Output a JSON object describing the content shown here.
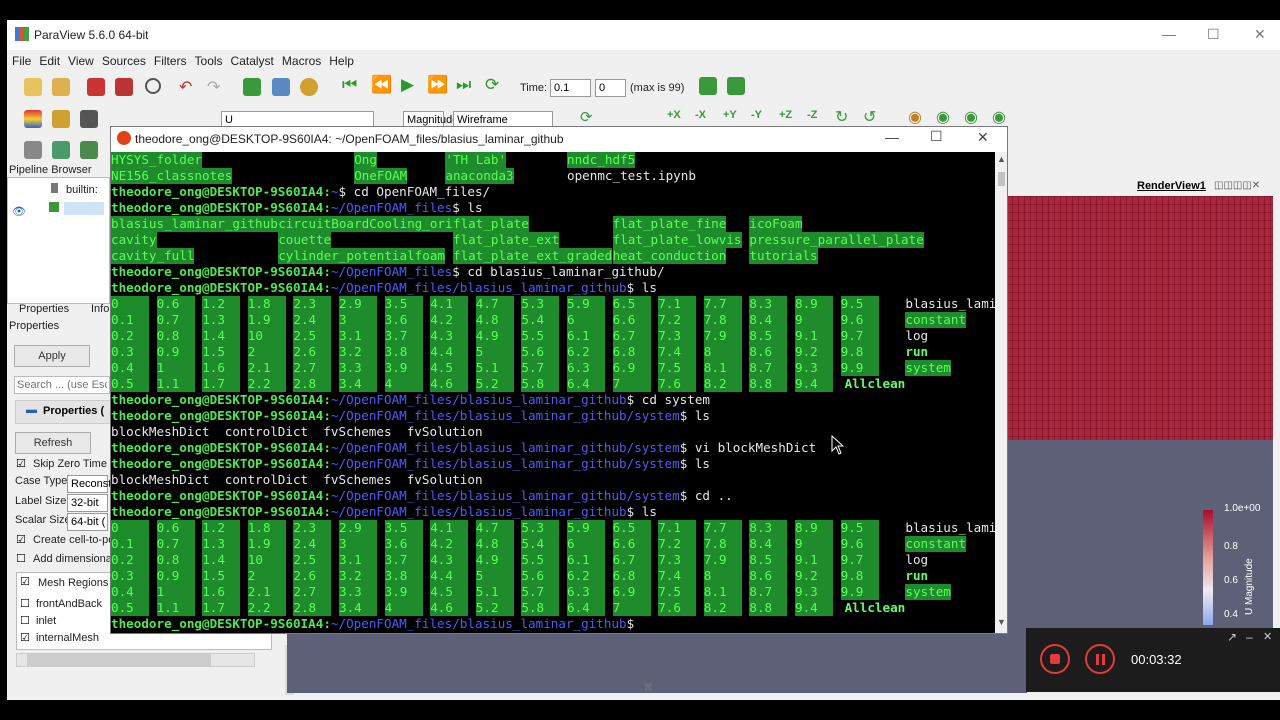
{
  "paraview": {
    "title": "ParaView 5.6.0 64-bit",
    "menu": [
      "File",
      "Edit",
      "View",
      "Sources",
      "Filters",
      "Tools",
      "Catalyst",
      "Macros",
      "Help"
    ],
    "time_label": "Time:",
    "time_value": "0.1",
    "timestep_value": "0",
    "max_label": "(max is 99)",
    "variable_combo": "U",
    "component_combo": "Magnitude",
    "representation_combo": "Wireframe",
    "pipeline_browser_label": "Pipeline Browser",
    "pipeline_builtin": "builtin:",
    "properties_tab": "Properties",
    "info_tab": "Info",
    "properties_header": "Properties",
    "apply_label": "Apply",
    "search_placeholder": "Search ... (use Esc",
    "properties_section": "Properties (",
    "refresh_label": "Refresh",
    "skip_zero_time": "Skip Zero Time",
    "case_type_label": "Case Type",
    "case_type_value": "Reconst",
    "label_size_label": "Label Size",
    "label_size_value": "32-bit",
    "scalar_size_label": "Scalar Size",
    "scalar_size_value": "64-bit (",
    "create_cell_label": "Create cell-to-po",
    "add_dimensional_label": "Add dimensiona",
    "mesh_regions_label": "Mesh Regions",
    "mesh_regions": [
      {
        "label": "frontAndBack",
        "checked": false
      },
      {
        "label": "inlet",
        "checked": false
      },
      {
        "label": "internalMesh",
        "checked": true
      }
    ],
    "render_view_label": "RenderView1",
    "colorbar_labels": [
      "1.0e+00",
      "0.8",
      "0.6",
      "0.4"
    ],
    "colorbar_title": "U Magnitude",
    "colors": {
      "render_red": "#a8283f",
      "render_bg": "#5d6077"
    }
  },
  "terminal": {
    "title": "theodore_ong@DESKTOP-9S60IA4: ~/OpenFOAM_files/blasius_laminar_github",
    "user": "theodore_ong@DESKTOP-9S60IA4",
    "lines": [
      {
        "type": "cols",
        "items": [
          [
            "HYSYS_folder",
            "hl",
            0
          ],
          [
            "Ong",
            "hl",
            32
          ],
          [
            "'TH Lab'",
            "hl",
            44
          ],
          [
            "nndc_hdf5",
            "hl",
            60
          ]
        ]
      },
      {
        "type": "cols",
        "items": [
          [
            "NE156_classnotes",
            "hl",
            0
          ],
          [
            "OneFOAM",
            "hl",
            32
          ],
          [
            "anaconda3",
            "hl",
            44
          ],
          [
            "openmc_test.ipynb",
            "plain",
            60
          ]
        ]
      },
      {
        "type": "prompt",
        "path": "~",
        "cmd": "$ cd OpenFOAM_files/"
      },
      {
        "type": "prompt",
        "path": "~/OpenFOAM_files",
        "cmd": "$ ls"
      },
      {
        "type": "cols",
        "items": [
          [
            "blasius_laminar_github",
            "hl",
            0
          ],
          [
            "circuitBoardCooling_orig",
            "hl",
            22
          ],
          [
            "flat_plate",
            "hl",
            45
          ],
          [
            "flat_plate_fine",
            "hl",
            66
          ],
          [
            "icoFoam",
            "hl",
            84
          ]
        ]
      },
      {
        "type": "cols",
        "items": [
          [
            "cavity",
            "hl",
            0
          ],
          [
            "couette",
            "hl",
            22
          ],
          [
            "flat_plate_ext",
            "hl",
            45
          ],
          [
            "flat_plate_lowvis",
            "hl",
            66
          ],
          [
            "pressure_parallel_plate",
            "hl",
            84
          ]
        ]
      },
      {
        "type": "cols",
        "items": [
          [
            "cavity_full",
            "hl",
            0
          ],
          [
            "cylinder_potentialfoam",
            "hl",
            22
          ],
          [
            "flat_plate_ext_graded",
            "hl",
            45
          ],
          [
            "heat_conduction",
            "hl",
            66
          ],
          [
            "tutorials",
            "hl",
            84
          ]
        ]
      },
      {
        "type": "prompt",
        "path": "~/OpenFOAM_files",
        "cmd": "$ cd blasius_laminar_github/"
      },
      {
        "type": "prompt",
        "path": "~/OpenFOAM_files/blasius_laminar_github",
        "cmd": "$ ls"
      },
      {
        "type": "ts",
        "row": [
          "0",
          "0.6",
          "1.2",
          "1.8",
          "2.3",
          "2.9",
          "3.5",
          "4.1",
          "4.7",
          "5.3",
          "5.9",
          "6.5",
          "7.1",
          "7.7",
          "8.3",
          "8.9",
          "9.5"
        ],
        "extra": [
          "blasius_laminar_github.foam",
          "plain"
        ]
      },
      {
        "type": "ts",
        "row": [
          "0.1",
          "0.7",
          "1.3",
          "1.9",
          "2.4",
          "3",
          "3.6",
          "4.2",
          "4.8",
          "5.4",
          "6",
          "6.6",
          "7.2",
          "7.8",
          "8.4",
          "9",
          "9.6"
        ],
        "extra": [
          "constant",
          "hl"
        ]
      },
      {
        "type": "ts",
        "row": [
          "0.2",
          "0.8",
          "1.4",
          "10",
          "2.5",
          "3.1",
          "3.7",
          "4.3",
          "4.9",
          "5.5",
          "6.1",
          "6.7",
          "7.3",
          "7.9",
          "8.5",
          "9.1",
          "9.7"
        ],
        "extra": [
          "log",
          "plain"
        ]
      },
      {
        "type": "ts",
        "row": [
          "0.3",
          "0.9",
          "1.5",
          "2",
          "2.6",
          "3.2",
          "3.8",
          "4.4",
          "5",
          "5.6",
          "6.2",
          "6.8",
          "7.4",
          "8",
          "8.6",
          "9.2",
          "9.8"
        ],
        "extra": [
          "run",
          "gf"
        ]
      },
      {
        "type": "ts",
        "row": [
          "0.4",
          "1",
          "1.6",
          "2.1",
          "2.7",
          "3.3",
          "3.9",
          "4.5",
          "5.1",
          "5.7",
          "6.3",
          "6.9",
          "7.5",
          "8.1",
          "8.7",
          "9.3",
          "9.9"
        ],
        "extra": [
          "system",
          "hl"
        ]
      },
      {
        "type": "ts",
        "row": [
          "0.5",
          "1.1",
          "1.7",
          "2.2",
          "2.8",
          "3.4",
          "4",
          "4.6",
          "5.2",
          "5.8",
          "6.4",
          "7",
          "7.6",
          "8.2",
          "8.8",
          "9.4"
        ],
        "extra": [
          "Allclean",
          "gf"
        ]
      },
      {
        "type": "prompt",
        "path": "~/OpenFOAM_files/blasius_laminar_github",
        "cmd": "$ cd system"
      },
      {
        "type": "prompt",
        "path": "~/OpenFOAM_files/blasius_laminar_github/system",
        "cmd": "$ ls"
      },
      {
        "type": "plain",
        "text": "blockMeshDict  controlDict  fvSchemes  fvSolution"
      },
      {
        "type": "prompt",
        "path": "~/OpenFOAM_files/blasius_laminar_github/system",
        "cmd": "$ vi blockMeshDict"
      },
      {
        "type": "prompt",
        "path": "~/OpenFOAM_files/blasius_laminar_github/system",
        "cmd": "$ ls"
      },
      {
        "type": "plain",
        "text": "blockMeshDict  controlDict  fvSchemes  fvSolution"
      },
      {
        "type": "prompt",
        "path": "~/OpenFOAM_files/blasius_laminar_github/system",
        "cmd": "$ cd .."
      },
      {
        "type": "prompt",
        "path": "~/OpenFOAM_files/blasius_laminar_github",
        "cmd": "$ ls"
      },
      {
        "type": "ts",
        "row": [
          "0",
          "0.6",
          "1.2",
          "1.8",
          "2.3",
          "2.9",
          "3.5",
          "4.1",
          "4.7",
          "5.3",
          "5.9",
          "6.5",
          "7.1",
          "7.7",
          "8.3",
          "8.9",
          "9.5"
        ],
        "extra": [
          "blasius_laminar_github.foam",
          "plain"
        ]
      },
      {
        "type": "ts",
        "row": [
          "0.1",
          "0.7",
          "1.3",
          "1.9",
          "2.4",
          "3",
          "3.6",
          "4.2",
          "4.8",
          "5.4",
          "6",
          "6.6",
          "7.2",
          "7.8",
          "8.4",
          "9",
          "9.6"
        ],
        "extra": [
          "constant",
          "hl"
        ]
      },
      {
        "type": "ts",
        "row": [
          "0.2",
          "0.8",
          "1.4",
          "10",
          "2.5",
          "3.1",
          "3.7",
          "4.3",
          "4.9",
          "5.5",
          "6.1",
          "6.7",
          "7.3",
          "7.9",
          "8.5",
          "9.1",
          "9.7"
        ],
        "extra": [
          "log",
          "plain"
        ]
      },
      {
        "type": "ts",
        "row": [
          "0.3",
          "0.9",
          "1.5",
          "2",
          "2.6",
          "3.2",
          "3.8",
          "4.4",
          "5",
          "5.6",
          "6.2",
          "6.8",
          "7.4",
          "8",
          "8.6",
          "9.2",
          "9.8"
        ],
        "extra": [
          "run",
          "gf"
        ]
      },
      {
        "type": "ts",
        "row": [
          "0.4",
          "1",
          "1.6",
          "2.1",
          "2.7",
          "3.3",
          "3.9",
          "4.5",
          "5.1",
          "5.7",
          "6.3",
          "6.9",
          "7.5",
          "8.1",
          "8.7",
          "9.3",
          "9.9"
        ],
        "extra": [
          "system",
          "hl"
        ]
      },
      {
        "type": "ts",
        "row": [
          "0.5",
          "1.1",
          "1.7",
          "2.2",
          "2.8",
          "3.4",
          "4",
          "4.6",
          "5.2",
          "5.8",
          "6.4",
          "7",
          "7.6",
          "8.2",
          "8.8",
          "9.4"
        ],
        "extra": [
          "Allclean",
          "gf"
        ]
      },
      {
        "type": "prompt",
        "path": "~/OpenFOAM_files/blasius_laminar_github",
        "cmd": "$"
      }
    ]
  },
  "recorder": {
    "elapsed": "00:03:32"
  }
}
